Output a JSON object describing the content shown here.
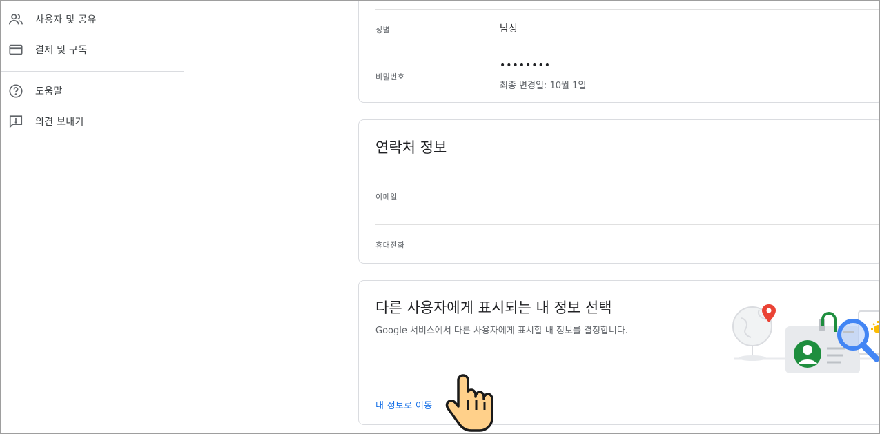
{
  "sidebar": {
    "items": [
      {
        "label": "사용자 및 공유",
        "icon": "people-icon"
      },
      {
        "label": "결제 및 구독",
        "icon": "credit-card-icon"
      },
      {
        "label": "도움말",
        "icon": "help-icon"
      },
      {
        "label": "의견 보내기",
        "icon": "feedback-icon"
      }
    ]
  },
  "personal": {
    "gender_label": "성별",
    "gender_value": "남성",
    "password_label": "비밀번호",
    "password_value": "••••••••",
    "password_changed": "최종 변경일: 10월 1일"
  },
  "contact": {
    "title": "연락처 정보",
    "email_label": "이메일",
    "phone_label": "휴대전화"
  },
  "visibility": {
    "title": "다른 사용자에게 표시되는 내 정보 선택",
    "description": "Google 서비스에서 다른 사용자에게 표시할 내 정보를 결정합니다.",
    "link": "내 정보로 이동"
  },
  "colors": {
    "link": "#1a73e8",
    "border": "#dadce0",
    "green": "#1e8e3e",
    "blue": "#4285f4",
    "red": "#ea4335",
    "yellow": "#fbbc04"
  }
}
